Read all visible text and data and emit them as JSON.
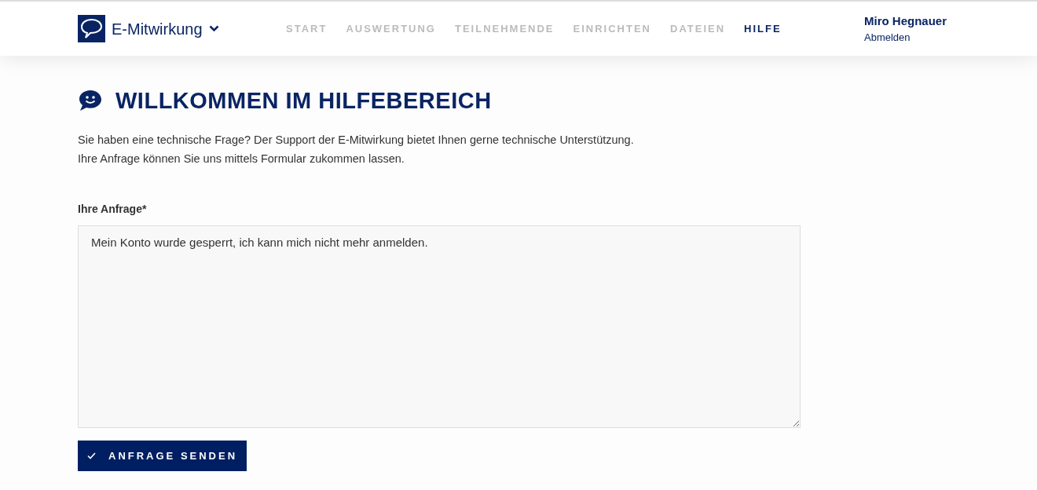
{
  "brand": {
    "name": "E-Mitwirkung"
  },
  "nav": [
    {
      "label": "START",
      "selected": false
    },
    {
      "label": "AUSWERTUNG",
      "selected": false
    },
    {
      "label": "TEILNEHMENDE",
      "selected": false
    },
    {
      "label": "EINRICHTEN",
      "selected": false
    },
    {
      "label": "DATEIEN",
      "selected": false
    },
    {
      "label": "HILFE",
      "selected": true
    }
  ],
  "user": {
    "name": "Miro Hegnauer",
    "logout": "Abmelden"
  },
  "heading": "WILLKOMMEN IM HILFEBEREICH",
  "intro": [
    "Sie haben eine technische Frage? Der Support der E-Mitwirkung bietet Ihnen gerne technische Unterstützung.",
    "Ihre Anfrage können Sie uns mittels Formular zukommen lassen."
  ],
  "form": {
    "label": "Ihre Anfrage*",
    "value": "Mein Konto wurde gesperrt, ich kann mich nicht mehr anmelden.",
    "submit": "ANFRAGE SENDEN"
  }
}
